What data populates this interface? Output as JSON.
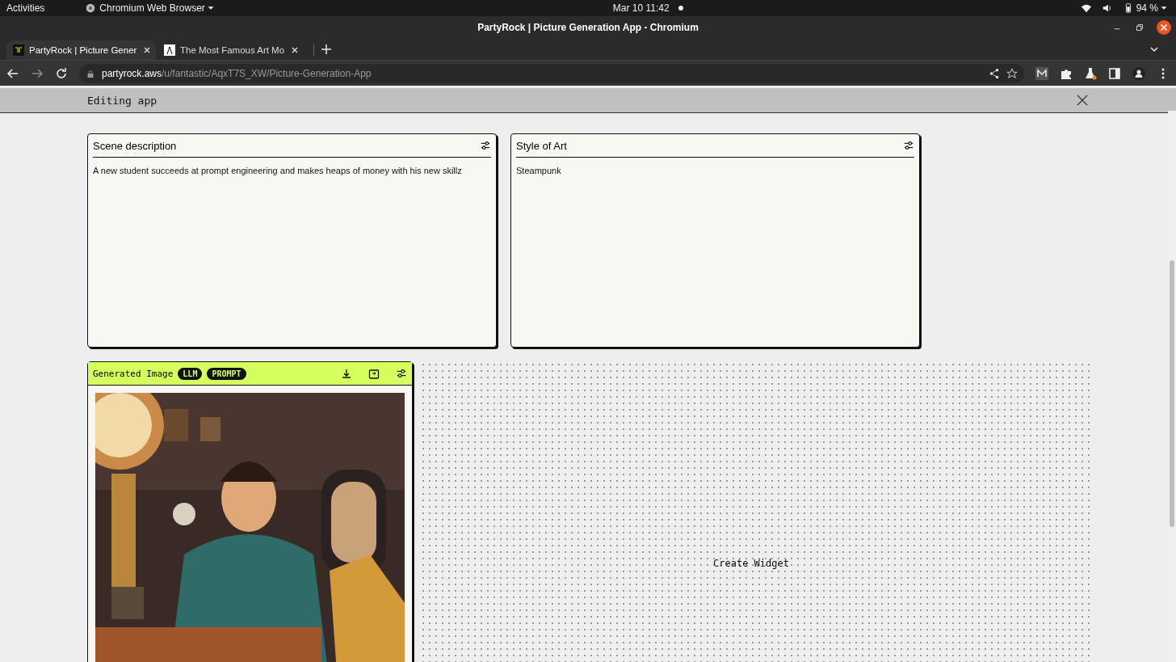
{
  "system_bar": {
    "activities": "Activities",
    "app_menu": "Chromium Web Browser",
    "clock": "Mar 10  11:42",
    "battery": "94 %"
  },
  "window": {
    "title": "PartyRock | Picture Generation App - Chromium"
  },
  "tabs": [
    {
      "title": "PartyRock | Picture Gener",
      "selected": true
    },
    {
      "title": "The Most Famous Art Mo",
      "selected": false
    }
  ],
  "address": {
    "domain": "partyrock.aws",
    "path": "/u/fantastic/AqxT7S_XW/Picture-Generation-App"
  },
  "app_header": {
    "title": "Editing app"
  },
  "widgets": [
    {
      "kind": "text",
      "title": "Scene description",
      "value": "A new student succeeds at prompt engineering and makes heaps of money with his new skillz"
    },
    {
      "kind": "text",
      "title": "Style of Art",
      "value": "Steampunk"
    },
    {
      "title": "Generated Image",
      "badges": [
        "LLM",
        "PROMPT"
      ]
    }
  ],
  "canvas": {
    "action": "Create Widget"
  }
}
